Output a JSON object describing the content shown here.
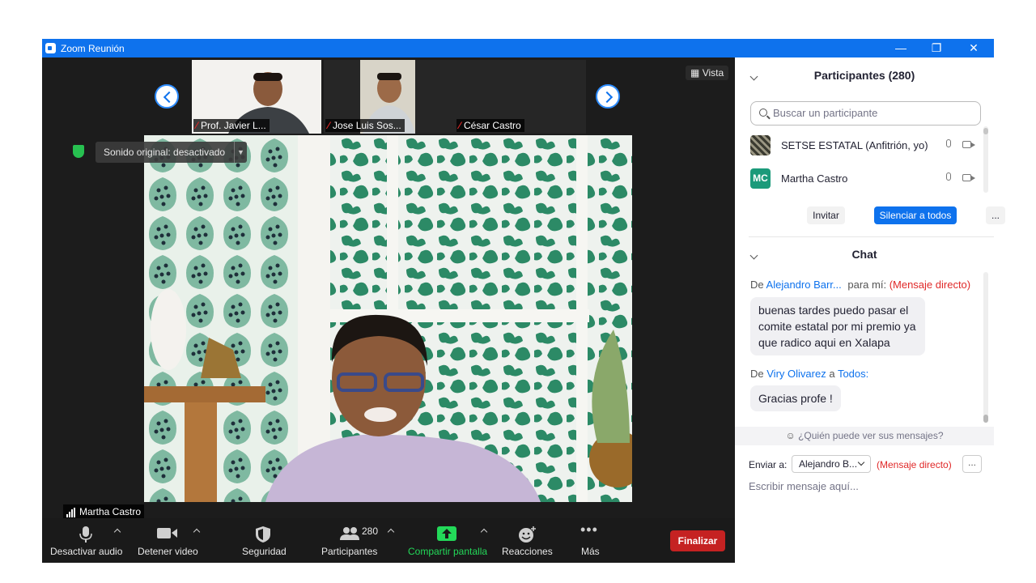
{
  "window": {
    "title": "Zoom Reunión"
  },
  "video": {
    "view_label": "Vista",
    "thumbnails": [
      {
        "name": "Prof. Javier L..."
      },
      {
        "name": "Jose Luis Sos..."
      },
      {
        "name": "César Castro"
      }
    ],
    "sound_notice": "Sonido original: desactivado",
    "speaker_name": "Martha Castro"
  },
  "toolbar": {
    "audio_label": "Desactivar audio",
    "video_label": "Detener video",
    "security_label": "Seguridad",
    "participants_label": "Participantes",
    "participants_count": "280",
    "share_label": "Compartir pantalla",
    "reactions_label": "Reacciones",
    "more_label": "Más",
    "end_label": "Finalizar"
  },
  "participants": {
    "title": "Participantes (280)",
    "search_placeholder": "Buscar un participante",
    "list": [
      {
        "name": "SETSE ESTATAL (Anfitrión, yo)",
        "avatar": ""
      },
      {
        "name": "Martha Castro",
        "avatar": "MC"
      }
    ],
    "invite_label": "Invitar",
    "mute_all_label": "Silenciar a todos",
    "more_label": "..."
  },
  "chat": {
    "title": "Chat",
    "messages": [
      {
        "from_prefix": "De",
        "sender": "Alejandro Barr...",
        "to_prefix": "para mí:",
        "recipient": "",
        "tag": "(Mensaje directo)",
        "text": "buenas tardes puedo pasar el comite estatal por mi premio ya que radico aqui en Xalapa"
      },
      {
        "from_prefix": "De",
        "sender": "Viry Olivarez",
        "to_prefix": "a",
        "recipient": "Todos:",
        "tag": "",
        "text": "Gracias profe !"
      }
    ],
    "who_sees": "¿Quién puede ver sus mensajes?",
    "send_to_label": "Enviar a:",
    "send_to_value": "Alejandro B...",
    "direct_tag": "(Mensaje directo)",
    "more_label": "...",
    "input_placeholder": "Escribir mensaje aquí..."
  },
  "colors": {
    "zoom_blue": "#0e72ed",
    "end_red": "#c52222",
    "share_green": "#23d959",
    "mc_avatar": "#1b9a7a"
  }
}
